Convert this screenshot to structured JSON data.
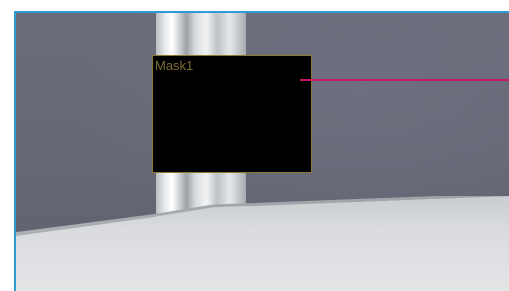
{
  "viewer": {
    "accent_border": "#2e9ad6",
    "mask": {
      "label": "Mask1",
      "fill_color": "#000000",
      "border_color": "#8a7a2e",
      "label_color": "#7a6d34"
    },
    "guide_line": {
      "color": "#c2186b"
    }
  }
}
